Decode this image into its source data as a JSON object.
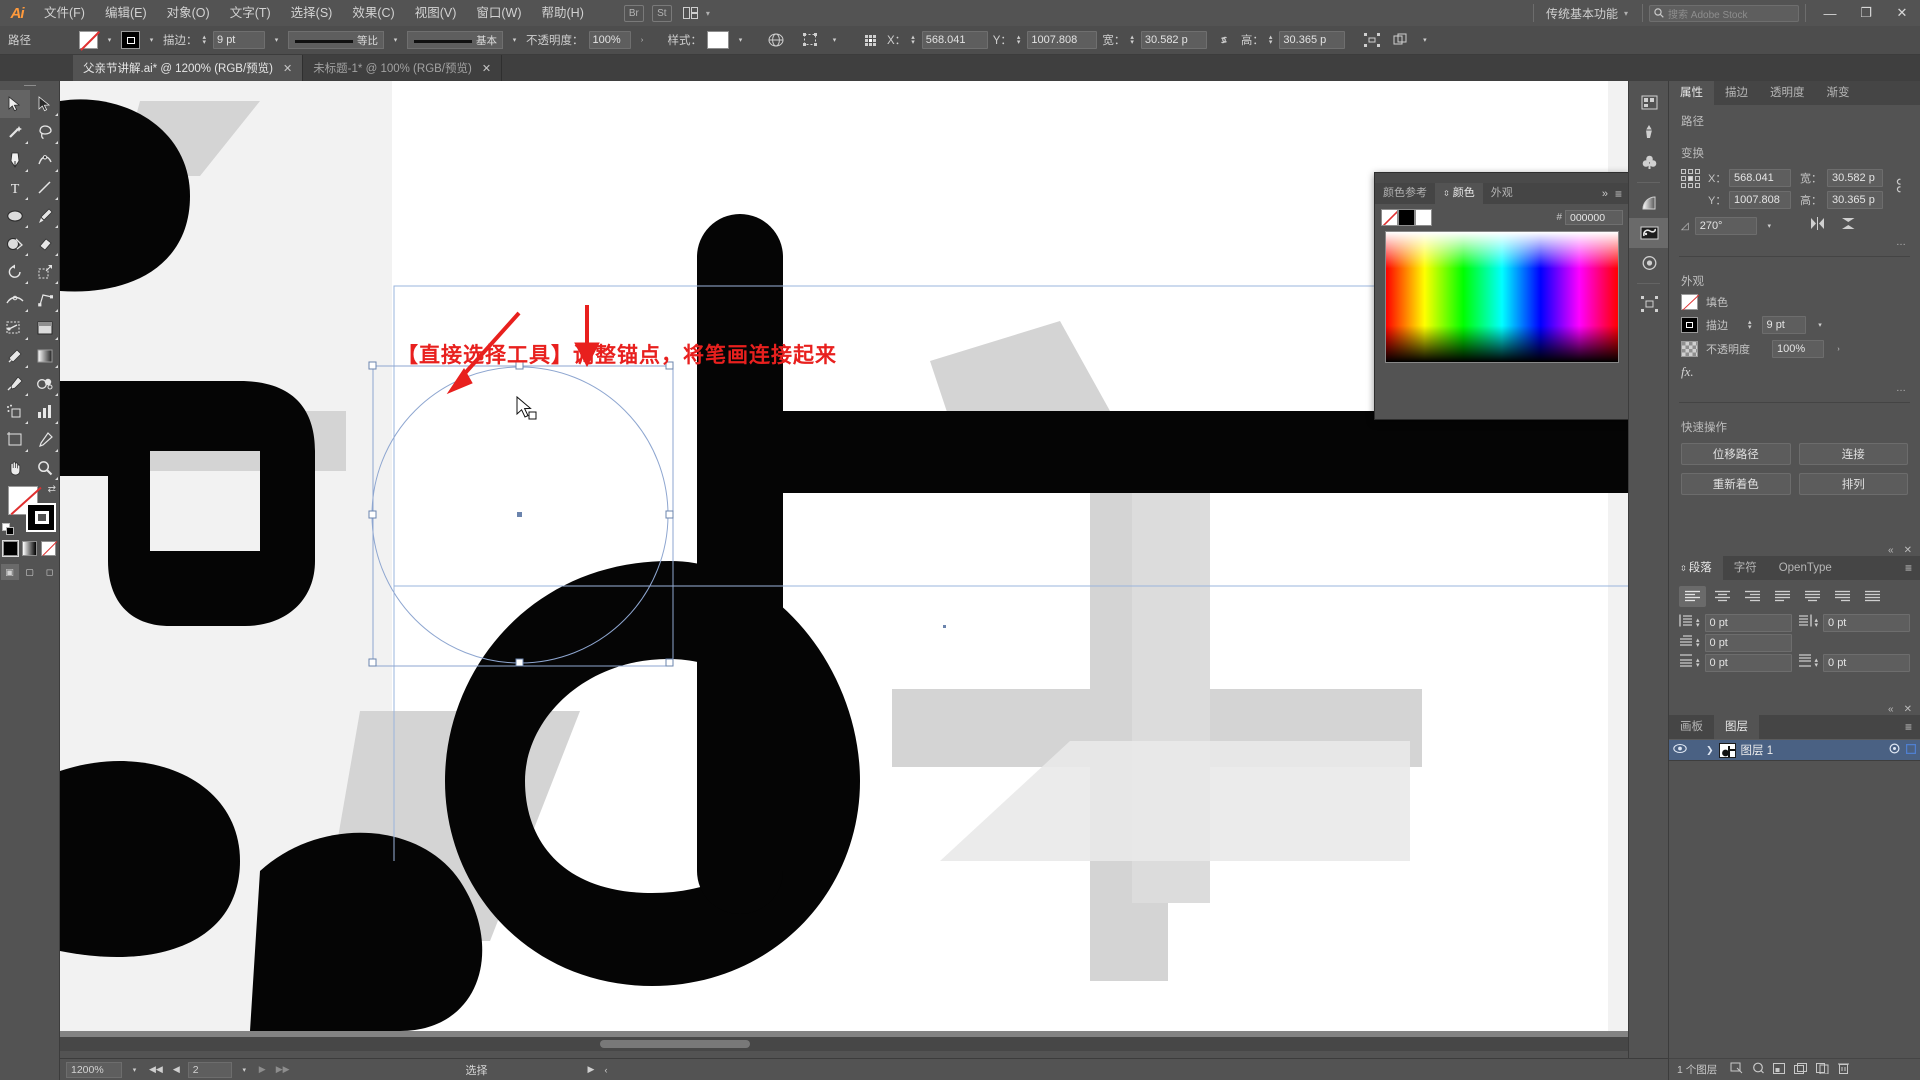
{
  "app": {
    "name": "Adobe Illustrator",
    "logo": "Ai"
  },
  "menubar": {
    "items": [
      {
        "label": "文件(F)"
      },
      {
        "label": "编辑(E)"
      },
      {
        "label": "对象(O)"
      },
      {
        "label": "文字(T)"
      },
      {
        "label": "选择(S)"
      },
      {
        "label": "效果(C)"
      },
      {
        "label": "视图(V)"
      },
      {
        "label": "窗口(W)"
      },
      {
        "label": "帮助(H)"
      }
    ],
    "bridge_icon": "Br",
    "stock_icon": "St",
    "arrange_icon": "arrange-documents-icon",
    "workspace": "传统基本功能",
    "search_placeholder": "搜索 Adobe Stock",
    "minimize": "—",
    "restore": "❐",
    "close": "✕"
  },
  "controlbar": {
    "object_label": "路径",
    "fill_swatch": "none-swatch",
    "stroke_swatch": "black-stroke-swatch",
    "stroke_label": "描边：",
    "stroke_weight": "9 pt",
    "profile_label": "等比",
    "brush_label": "基本",
    "opacity_label": "不透明度：",
    "opacity_value": "100%",
    "style_label": "样式：",
    "x_label": "X：",
    "x_value": "568.041",
    "y_label": "Y：",
    "y_value": "1007.808",
    "w_label": "宽：",
    "w_value": "30.582 p",
    "h_label": "高：",
    "h_value": "30.365 p",
    "link_icon": "unlink-icon"
  },
  "tabs": [
    {
      "label": "父亲节讲解.ai* @ 1200% (RGB/预览)",
      "active": true,
      "close": "✕"
    },
    {
      "label": "未标题-1* @ 100% (RGB/预览)",
      "active": false,
      "close": "✕"
    }
  ],
  "toolbar": {
    "tools": [
      {
        "name": "selection-tool",
        "selected": true
      },
      {
        "name": "direct-selection-tool",
        "selected": false
      },
      {
        "name": "magic-wand-tool",
        "selected": false
      },
      {
        "name": "lasso-tool",
        "selected": false
      },
      {
        "name": "pen-tool",
        "selected": false
      },
      {
        "name": "curvature-tool",
        "selected": false
      },
      {
        "name": "type-tool",
        "selected": false
      },
      {
        "name": "line-segment-tool",
        "selected": false
      },
      {
        "name": "ellipse-tool",
        "selected": false
      },
      {
        "name": "paintbrush-tool",
        "selected": false
      },
      {
        "name": "shaper-tool",
        "selected": false
      },
      {
        "name": "eraser-tool",
        "selected": false
      },
      {
        "name": "rotate-tool",
        "selected": false
      },
      {
        "name": "scale-tool",
        "selected": false
      },
      {
        "name": "width-tool",
        "selected": false
      },
      {
        "name": "free-transform-tool",
        "selected": false
      },
      {
        "name": "shape-builder-tool",
        "selected": false
      },
      {
        "name": "perspective-grid-tool",
        "selected": false
      },
      {
        "name": "mesh-tool",
        "selected": false
      },
      {
        "name": "gradient-tool",
        "selected": false
      },
      {
        "name": "eyedropper-tool",
        "selected": false
      },
      {
        "name": "blend-tool",
        "selected": false
      },
      {
        "name": "symbol-sprayer-tool",
        "selected": false
      },
      {
        "name": "column-graph-tool",
        "selected": false
      },
      {
        "name": "artboard-tool",
        "selected": false
      },
      {
        "name": "slice-tool",
        "selected": false
      },
      {
        "name": "hand-tool",
        "selected": false
      },
      {
        "name": "zoom-tool",
        "selected": false
      }
    ],
    "fill_stroke": {
      "fill": "none",
      "stroke": "#000000"
    },
    "color_modes": [
      "color-mode-icon",
      "gradient-mode-icon",
      "none-mode-icon"
    ],
    "screen_modes": [
      "normal-screen-mode-icon",
      "full-screen-menubar-icon",
      "full-screen-icon"
    ]
  },
  "canvas": {
    "annotation": "【直接选择工具】调整锚点，将笔画连接起来",
    "annotation_color": "#e8201e",
    "arrows": 2,
    "cursor": "arrow-cursor",
    "selection_box": "selected-path-bounding-box"
  },
  "color_panel": {
    "tabs": [
      {
        "label": "颜色参考",
        "active": false
      },
      {
        "label": "颜色",
        "active": true
      },
      {
        "label": "外观",
        "active": false
      }
    ],
    "expand": "»",
    "menu": "≡",
    "hex_label": "#",
    "hex_value": "000000",
    "swatches": [
      "none",
      "#000000",
      "#ffffff"
    ]
  },
  "right_rail": {
    "icons": [
      "libraries-icon",
      "brushes-icon",
      "symbols-icon",
      "gradient-icon",
      "swatches-icon",
      "color-guide-icon",
      "align-icon"
    ]
  },
  "properties": {
    "tabs": [
      {
        "label": "属性",
        "active": true
      },
      {
        "label": "描边",
        "active": false
      },
      {
        "label": "透明度",
        "active": false
      },
      {
        "label": "渐变",
        "active": false
      }
    ],
    "object_title": "路径",
    "transform_title": "变换",
    "x_label": "X：",
    "x_value": "568.041",
    "y_label": "Y：",
    "y_value": "1007.808",
    "w_label": "宽：",
    "w_value": "30.582 p",
    "h_label": "高：",
    "h_value": "30.365 p",
    "angle_label": "角度",
    "angle_value": "270°",
    "link_icon": "unlink-icon",
    "flip_h_icon": "flip-horizontal-icon",
    "flip_v_icon": "flip-vertical-icon",
    "more_options": "…",
    "appearance_title": "外观",
    "fill_label": "填色",
    "stroke_label": "描边",
    "stroke_value": "9 pt",
    "opacity_label": "不透明度",
    "opacity_value": "100%",
    "fx_label": "fx.",
    "quick_title": "快速操作",
    "quick_buttons": [
      "位移路径",
      "连接",
      "重新着色",
      "排列"
    ]
  },
  "paragraph": {
    "tabs": [
      {
        "label": "段落",
        "active": true
      },
      {
        "label": "字符",
        "active": false
      },
      {
        "label": "OpenType",
        "active": false
      }
    ],
    "menu": "≡",
    "collapse": "«",
    "close": "✕",
    "align_buttons": [
      "align-left",
      "align-center",
      "align-right",
      "justify-last-left",
      "justify-last-center",
      "justify-last-right",
      "justify-all"
    ],
    "indent_left": "0 pt",
    "indent_right": "0 pt",
    "indent_first": "0 pt",
    "space_before": "0 pt",
    "space_after": "0 pt"
  },
  "layers": {
    "tabs": [
      {
        "label": "画板",
        "active": false
      },
      {
        "label": "图层",
        "active": true
      }
    ],
    "menu": "≡",
    "collapse": "«",
    "close": "✕",
    "rows": [
      {
        "name": "图层 1",
        "visible": true,
        "locked": false,
        "selected": true,
        "eye_icon": "eye-icon",
        "expand_icon": "chevron-right-icon",
        "target_icon": "target-circle-icon",
        "select_icon": "selection-square-icon"
      }
    ],
    "footer_count": "1 个图层",
    "footer_icons": [
      "locate-object-icon",
      "make-clipping-mask-icon",
      "create-sublayer-icon",
      "create-new-layer-icon",
      "delete-layer-icon"
    ]
  },
  "statusbar": {
    "zoom": "1200%",
    "first_icon": "◀◀",
    "prev_icon": "◀",
    "page": "2",
    "next_icon": "▶",
    "last_icon": "▶▶",
    "status_text": "选择",
    "right_icons": [
      "▶",
      "‹"
    ]
  }
}
